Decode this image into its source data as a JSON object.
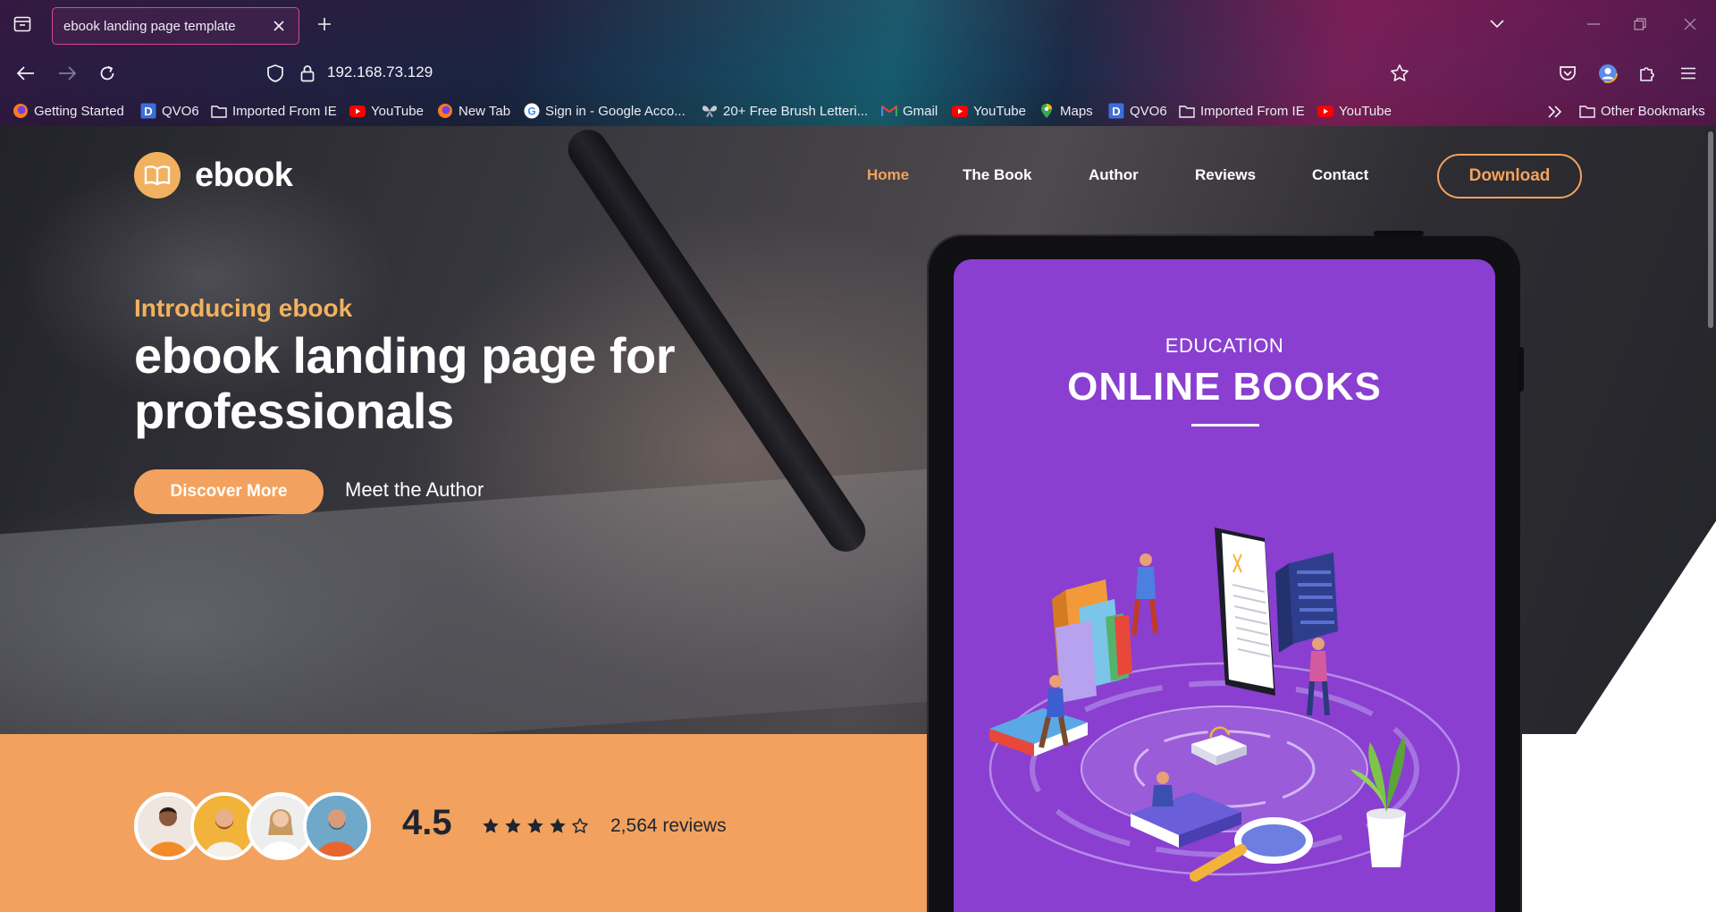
{
  "browser": {
    "tab_title": "ebook landing page template",
    "url": "192.168.73.129",
    "bookmarks": [
      {
        "label": "Getting Started",
        "icon": "firefox-icon"
      },
      {
        "label": "QVO6",
        "icon": "qvo6-icon"
      },
      {
        "label": "Imported From IE",
        "icon": "folder-icon"
      },
      {
        "label": "YouTube",
        "icon": "youtube-icon"
      },
      {
        "label": "New Tab",
        "icon": "firefox-icon"
      },
      {
        "label": "Sign in - Google Acco...",
        "icon": "google-icon"
      },
      {
        "label": "20+ Free Brush Letteri...",
        "icon": "butterfly-icon"
      },
      {
        "label": "Gmail",
        "icon": "gmail-icon"
      },
      {
        "label": "YouTube",
        "icon": "youtube-icon"
      },
      {
        "label": "Maps",
        "icon": "maps-icon"
      },
      {
        "label": "QVO6",
        "icon": "qvo6-icon"
      },
      {
        "label": "Imported From IE",
        "icon": "folder-icon"
      },
      {
        "label": "YouTube",
        "icon": "youtube-icon"
      }
    ],
    "other_bookmarks": "Other Bookmarks"
  },
  "site": {
    "logo_text": "ebook",
    "nav": [
      {
        "label": "Home",
        "active": true
      },
      {
        "label": "The Book",
        "active": false
      },
      {
        "label": "Author",
        "active": false
      },
      {
        "label": "Reviews",
        "active": false
      },
      {
        "label": "Contact",
        "active": false
      }
    ],
    "download_label": "Download",
    "accent_color": "#f2a25e"
  },
  "hero": {
    "eyebrow": "Introducing ebook",
    "headline_line1": "ebook landing page for",
    "headline_line2": "professionals",
    "primary_cta": "Discover More",
    "secondary_cta": "Meet the Author"
  },
  "rating": {
    "value": "4.5",
    "stars_filled": 4,
    "stars_total": 5,
    "reviews": "2,564 reviews"
  },
  "book_cover": {
    "eyebrow": "EDUCATION",
    "title": "ONLINE BOOKS",
    "background_color": "#8a3fd0"
  }
}
